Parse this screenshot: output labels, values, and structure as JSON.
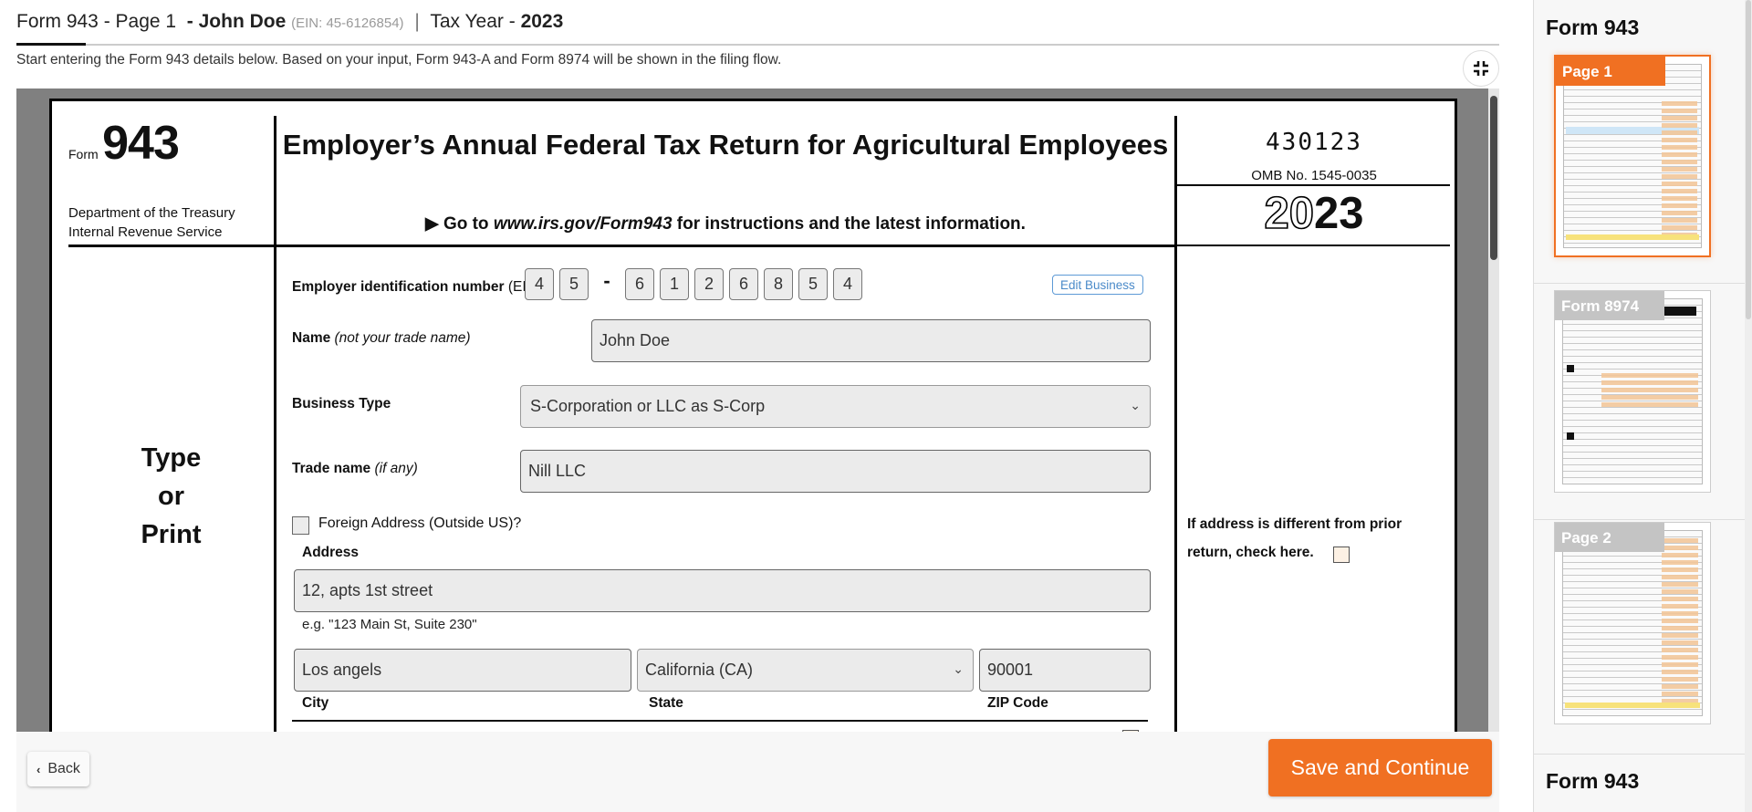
{
  "header": {
    "form_page": "Form 943 - Page 1",
    "name_prefix": "- ",
    "taxpayer_name": "John Doe",
    "ein_text": "(EIN: 45-6126854)",
    "separator": "|",
    "tax_year_label": "Tax Year -",
    "tax_year": "2023",
    "subtitle": "Start entering the Form 943 details below. Based on your input, Form 943-A and Form 8974 will be shown in the filing flow."
  },
  "icons": {
    "collapse": "collapse-arrows-icon",
    "back_chevron": "chevron-left-icon",
    "select_chevron": "chevron-down-icon"
  },
  "form": {
    "form_word": "Form",
    "form_number": "943",
    "dept_line1": "Department of the Treasury",
    "dept_line2": "Internal Revenue Service",
    "title": "Employer’s Annual Federal Tax Return for Agricultural Employees",
    "goto_prefix": "▶ Go to ",
    "goto_url": "www.irs.gov/Form943",
    "goto_suffix": " for instructions and the latest information.",
    "code": "430123",
    "omb": "OMB No. 1545-0035",
    "year_outline": "20",
    "year_solid": "23",
    "type_print": [
      "Type",
      "or",
      "Print"
    ],
    "ein_label_bold": "Employer identification number",
    "ein_label_rest": " (EIN)",
    "ein_digits": [
      "4",
      "5",
      "6",
      "1",
      "2",
      "6",
      "8",
      "5",
      "4"
    ],
    "ein_dash": "-",
    "edit_business": "Edit Business",
    "name_label_bold": "Name",
    "name_label_italic": " (not your trade name)",
    "name_value": "John Doe",
    "business_type_label": "Business Type",
    "business_type_value": "S-Corporation or LLC as S-Corp",
    "trade_name_label_bold": "Trade name",
    "trade_name_label_italic": " (if any)",
    "trade_name_value": "Nill LLC",
    "foreign_address_label": "Foreign Address (Outside US)?",
    "foreign_address_checked": false,
    "address_label": "Address",
    "address_value": "12, apts 1st street",
    "address_hint": "e.g. \"123 Main St, Suite 230\"",
    "city_value": "Los angels",
    "city_label": "City",
    "state_value": "California (CA)",
    "state_label": "State",
    "zip_value": "90001",
    "zip_label": "ZIP Code",
    "address_changed_note": "If address is different from prior return, check here.",
    "address_changed_checked": false
  },
  "footer": {
    "back_label": "Back",
    "save_label": "Save and Continue"
  },
  "sidebar": {
    "groups": [
      {
        "heading": "Form 943",
        "pages": [
          {
            "tag": "Page 1",
            "active": true
          }
        ]
      },
      {
        "heading": "",
        "pages": [
          {
            "tag": "Form 8974",
            "active": false
          }
        ]
      },
      {
        "heading": "",
        "pages": [
          {
            "tag": "Page 2",
            "active": false
          }
        ]
      },
      {
        "heading": "Form 943",
        "pages": []
      }
    ]
  },
  "colors": {
    "accent": "#f07022",
    "link_blue": "#4a8ac9",
    "field_bg": "#ebebeb",
    "viewer_gray": "#808080"
  }
}
